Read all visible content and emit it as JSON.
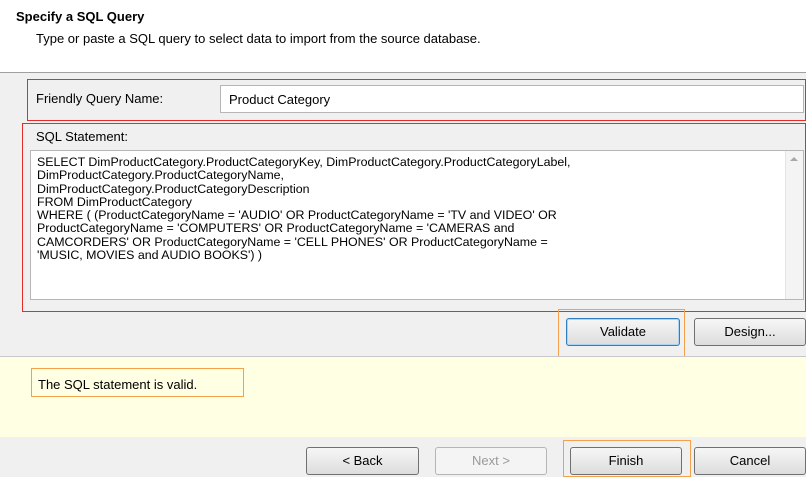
{
  "header": {
    "title": "Specify a SQL Query",
    "subtitle": "Type or paste a SQL query to select data to import from the source database."
  },
  "friendly_query": {
    "label": "Friendly Query Name:",
    "value": "Product Category"
  },
  "sql": {
    "label": "SQL Statement:",
    "text": "SELECT DimProductCategory.ProductCategoryKey, DimProductCategory.ProductCategoryLabel,\nDimProductCategory.ProductCategoryName,\nDimProductCategory.ProductCategoryDescription\nFROM DimProductCategory\nWHERE ( (ProductCategoryName = 'AUDIO' OR ProductCategoryName = 'TV and VIDEO' OR\nProductCategoryName = 'COMPUTERS' OR ProductCategoryName = 'CAMERAS and\nCAMCORDERS' OR ProductCategoryName = 'CELL PHONES' OR ProductCategoryName =\n'MUSIC, MOVIES and AUDIO BOOKS') )"
  },
  "actions": {
    "validate": "Validate",
    "design": "Design..."
  },
  "status": {
    "message": "The SQL statement is valid."
  },
  "footer": {
    "back": "< Back",
    "next": "Next >",
    "finish": "Finish",
    "cancel": "Cancel"
  },
  "colors": {
    "highlight_red": "#e62b2b",
    "highlight_orange": "#f5a04a",
    "status_background": "#ffffe4"
  }
}
